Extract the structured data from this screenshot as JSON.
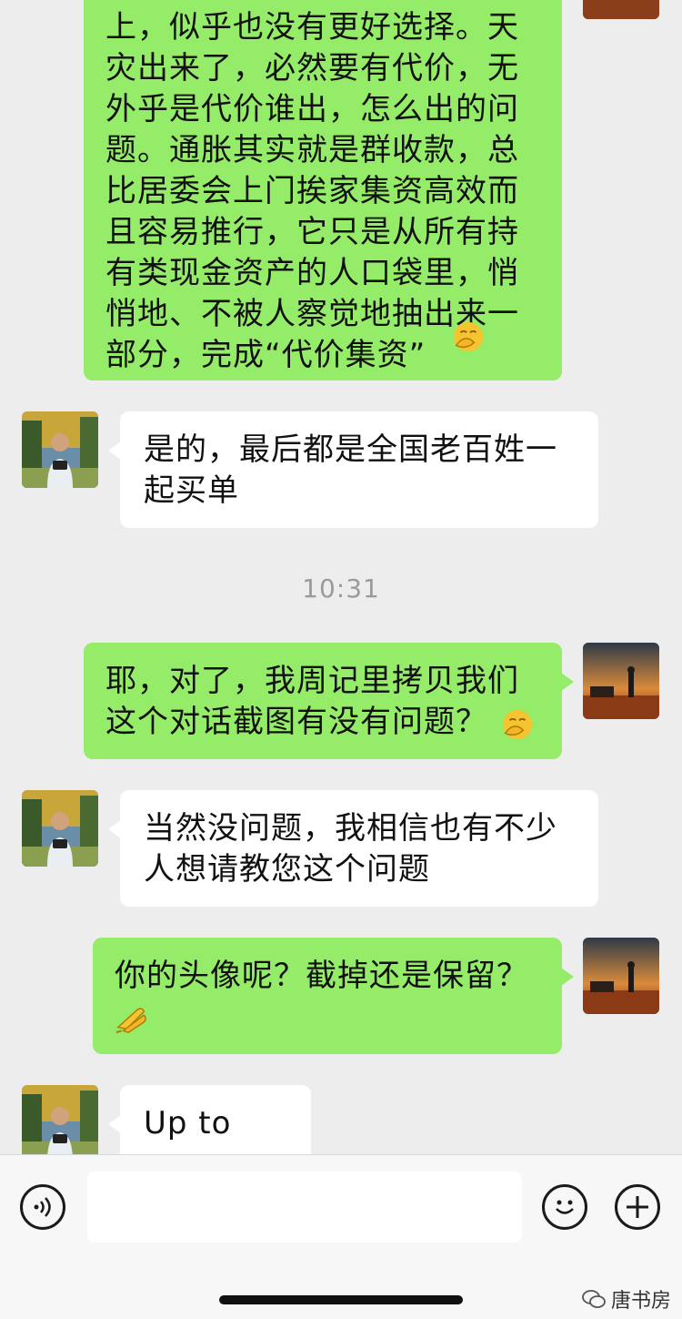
{
  "chat": {
    "messages": [
      {
        "from": "me",
        "text": "上，似乎也没有更好选择。天\n灾出来了，必然要有代价，无\n外乎是代价谁出，怎么出的问\n题。通胀其实就是群收款，总\n比居委会上门挨家集资高效而\n且容易推行，它只是从所有持\n有类现金资产的人口袋里，悄\n悄地、不被人察觉地抽出来一\n部分，完成“代价集资”",
        "emoji": "facepalm-smile-emoji"
      },
      {
        "from": "them",
        "text": "是的，最后都是全国老百姓一\n起买单"
      },
      {
        "from": "me",
        "text": "耶，对了，我周记里拷贝我们\n这个对话截图有没有问题？",
        "emoji": "facepalm-smile-emoji"
      },
      {
        "from": "them",
        "text": "当然没问题，我相信也有不少\n人想请教您这个问题"
      },
      {
        "from": "me",
        "text": "你的头像呢？截掉还是保留？",
        "emoji": "pray-hands-emoji"
      },
      {
        "from": "them",
        "text": "Up to you"
      }
    ],
    "timestamp": "10:31"
  },
  "input_bar": {
    "voice_icon": "voice-icon",
    "emoji_icon": "smiley-icon",
    "plus_icon": "plus-icon",
    "input_value": ""
  },
  "watermark": {
    "text": "唐书房",
    "icon": "wechat-official-account-icon"
  },
  "colors": {
    "me_bubble": "#95ec69",
    "them_bubble": "#ffffff",
    "background": "#ededed"
  }
}
